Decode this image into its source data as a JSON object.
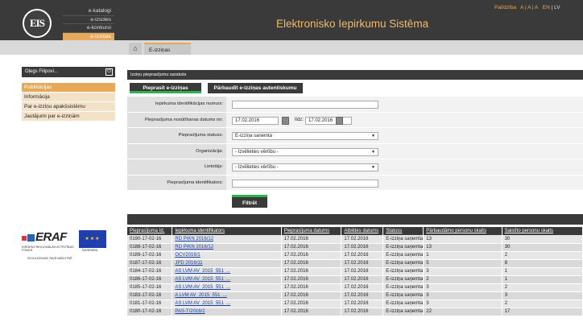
{
  "header": {
    "logo_text": "EIS",
    "app_title": "Elektronisko Iepirkumu Sistēma",
    "nav": [
      "e-katalogi",
      "e-izsoles",
      "e-konkursi",
      "e-izziņas"
    ],
    "links": {
      "help": "Palīdzība",
      "font_sizes": "A | A | A",
      "lang_en": "EN",
      "lang_lv": "LV"
    }
  },
  "breadcrumb": {
    "home_icon": "home-icon",
    "tab": "E-izziņas"
  },
  "sidebar": {
    "user": "Oļegs Filipovi...",
    "lock_icon": "lock-icon",
    "items": [
      "Publikācijas",
      "Informācija",
      "Par e-izziņu apakšsistēmu",
      "Jautājumi par e-izziņām"
    ]
  },
  "section_title": "Izziņu pieprasījumu saraksts",
  "buttons": {
    "request": "Pieprasīt e-izziņas",
    "verify": "Pārbaudīt e-izziņas autentiskumu",
    "filter": "Filtrēt"
  },
  "form": {
    "id_label": "Iepirkuma identifikācijas numurs:",
    "date_label": "Pieprasījuma nosūtīšanas datums no:",
    "date_from": "17.02.2016",
    "date_to_label": "līdz:",
    "date_to": "17.02.2016",
    "status_label": "Pieprasījuma statuss:",
    "status_value": "E-izziņa saņemta",
    "org_label": "Organizācija:",
    "org_value": "- Izvēlieties vērtību -",
    "user_label": "Lietotājs:",
    "user_value": "- Izvēlieties vērtību -",
    "req_id_label": "Pieprasījuma identifikators:"
  },
  "table": {
    "headers": [
      "Pieprasījuma Id.",
      "Iepirkuma identifikators",
      "Pieprasījuma datums",
      "Atbildes datums",
      "Statuss",
      "Pārbaudāmo personu skaits",
      "Saistīto personu skaits"
    ],
    "rows": [
      [
        "0190-17-02-16",
        "RD PIKN 2016/12",
        "17.02.2016",
        "17.02.2016",
        "E-izziņa saņemta",
        "13",
        "30"
      ],
      [
        "0188-17-02-16",
        "RD PIKN 2016/12",
        "17.02.2016",
        "17.02.2016",
        "E-izziņa saņemta",
        "13",
        "30"
      ],
      [
        "0189-17-02-16",
        "OCV2016/1",
        "17.02.2016",
        "17.02.2016",
        "E-izziņa saņemta",
        "1",
        "2"
      ],
      [
        "0187-17-02-16",
        "JPD 2016/11",
        "17.02.2016",
        "17.02.2016",
        "E-izziņa saņemta",
        "5",
        "8"
      ],
      [
        "0184-17-02-16",
        "AS LVM AV_2015_551_...",
        "17.02.2016",
        "17.02.2016",
        "E-izziņa saņemta",
        "3",
        "1"
      ],
      [
        "0186-17-02-16",
        "AS LVM AV_2015_551_...",
        "17.02.2016",
        "17.02.2016",
        "E-izziņa saņemta",
        "2",
        "1"
      ],
      [
        "0185-17-02-16",
        "AS LVM AV_2015_551_...",
        "17.02.2016",
        "17.02.2016",
        "E-izziņa saņemta",
        "3",
        "2"
      ],
      [
        "0183-17-02-16",
        "A LVM AV_2015_551_...",
        "17.02.2016",
        "17.02.2016",
        "E-izziņa saņemta",
        "3",
        "3"
      ],
      [
        "0181-17-02-16",
        "AS LVM AV_2015_551_...",
        "17.02.2016",
        "17.02.2016",
        "E-izziņa saņemta",
        "3",
        "2"
      ],
      [
        "0180-17-02-16",
        "PAS-T/2016/2",
        "17.02.2016",
        "17.02.2016",
        "E-izziņa saņemta",
        "22",
        "17"
      ]
    ]
  },
  "footer_logos": {
    "eraf": "ERAF",
    "eraf_sub_left": "EIROPAS REĢIONĀLĀS ATTĪSTĪBAS FONDS",
    "eraf_sub_right": "EIROPAS SAVIENĪBA",
    "invest": "IEGULDĪJUMS TAVĀ NĀKOTNĒ"
  },
  "colors": {
    "accent": "#e8a85a",
    "dark": "#3a3a3a",
    "green": "#2bb24c",
    "link": "#1a3fa0"
  }
}
